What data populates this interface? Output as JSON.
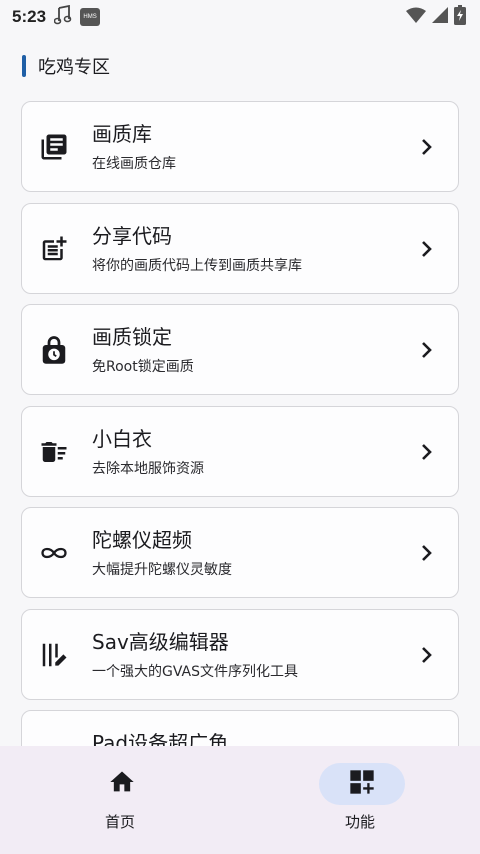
{
  "status_bar": {
    "time": "5:23",
    "icons": [
      "music-note-icon",
      "hms-badge-icon",
      "wifi-icon",
      "cellular-icon",
      "battery-charging-icon"
    ],
    "hms_text": "HMS"
  },
  "section": {
    "title": "吃鸡专区",
    "accent_color": "#1f5fa6"
  },
  "cards": [
    {
      "title": "画质库",
      "subtitle": "在线画质仓库",
      "icon": "library-books-icon"
    },
    {
      "title": "分享代码",
      "subtitle": "将你的画质代码上传到画质共享库",
      "icon": "post-add-icon"
    },
    {
      "title": "画质锁定",
      "subtitle": "免Root锁定画质",
      "icon": "lock-clock-icon"
    },
    {
      "title": "小白衣",
      "subtitle": "去除本地服饰资源",
      "icon": "delete-sweep-icon"
    },
    {
      "title": "陀螺仪超频",
      "subtitle": "大幅提升陀螺仪灵敏度",
      "icon": "infinity-icon"
    },
    {
      "title": "Sav高级编辑器",
      "subtitle": "一个强大的GVAS文件序列化工具",
      "icon": "edit-note-icon"
    },
    {
      "title": "Pad设备超广角",
      "subtitle": "",
      "icon": "tablet-icon"
    }
  ],
  "bottom_nav": {
    "items": [
      {
        "label": "首页",
        "icon": "home-icon",
        "active": false
      },
      {
        "label": "功能",
        "icon": "dashboard-add-icon",
        "active": true
      }
    ],
    "active_color": "#d9e2f8"
  }
}
